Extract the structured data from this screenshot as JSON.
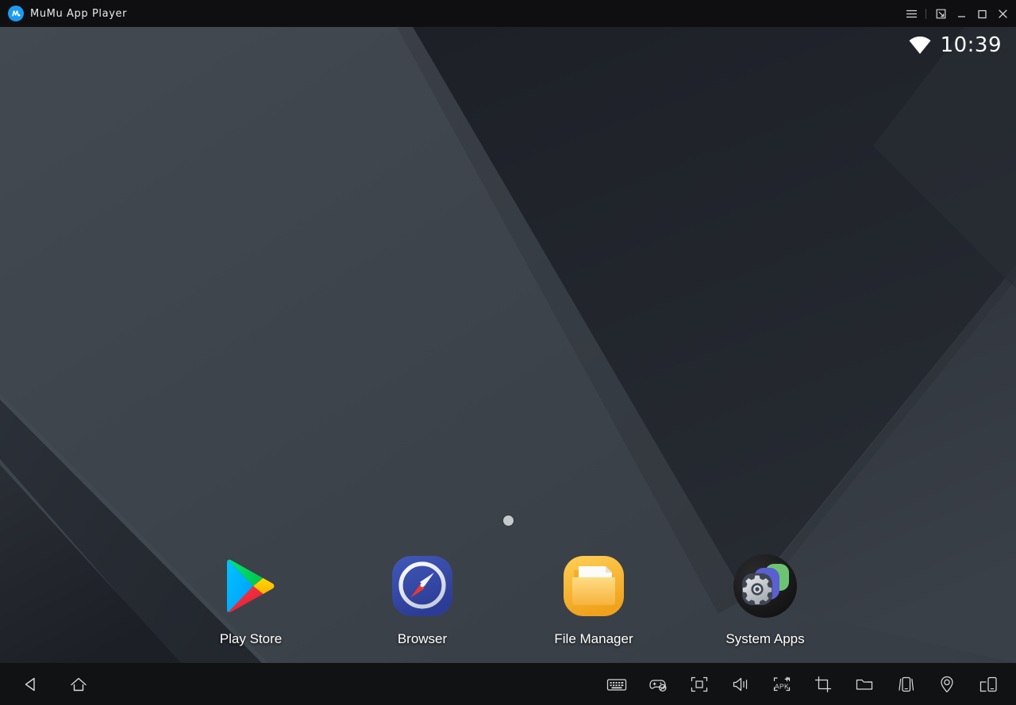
{
  "window": {
    "title": "MuMu App Player",
    "logo_icon": "mumu-logo-icon",
    "controls": [
      {
        "name": "menu-button",
        "icon": "hamburger-menu-icon",
        "label": "Menu"
      },
      {
        "name": "resize-button",
        "icon": "resize-window-icon",
        "label": "Resize"
      },
      {
        "name": "minimize-button",
        "icon": "minimize-icon",
        "label": "Minimize"
      },
      {
        "name": "maximize-button",
        "icon": "maximize-icon",
        "label": "Maximize"
      },
      {
        "name": "close-button",
        "icon": "close-icon",
        "label": "Close"
      }
    ]
  },
  "statusbar": {
    "wifi_icon": "wifi-icon",
    "time": "10:39"
  },
  "home": {
    "page_indicator": {
      "total": 1,
      "current": 1
    },
    "apps": [
      {
        "label": "Play Store",
        "icon": "play-store-icon"
      },
      {
        "label": "Browser",
        "icon": "browser-compass-icon"
      },
      {
        "label": "File Manager",
        "icon": "file-manager-folder-icon"
      },
      {
        "label": "System Apps",
        "icon": "system-apps-gear-icon"
      }
    ]
  },
  "navbar": {
    "system_buttons": [
      {
        "label": "Back",
        "icon": "back-triangle-icon"
      },
      {
        "label": "Home",
        "icon": "home-house-icon"
      }
    ],
    "tools": [
      {
        "label": "Keyboard Mapping",
        "icon": "keyboard-icon"
      },
      {
        "label": "Gamepad",
        "icon": "gamepad-disabled-icon"
      },
      {
        "label": "Full Screen",
        "icon": "fullscreen-icon"
      },
      {
        "label": "Volume",
        "icon": "volume-icon"
      },
      {
        "label": "Install APK",
        "icon": "install-apk-icon"
      },
      {
        "label": "Screenshot",
        "icon": "crop-screenshot-icon"
      },
      {
        "label": "Shared Folder",
        "icon": "folder-icon"
      },
      {
        "label": "Shake",
        "icon": "shake-phone-icon"
      },
      {
        "label": "Location",
        "icon": "location-pin-icon"
      },
      {
        "label": "Multi Window",
        "icon": "multi-window-icon"
      }
    ]
  },
  "colors": {
    "titlebar_bg": "#0f0f11",
    "navbar_bg": "#111214",
    "wallpaper_light": "#3d434b",
    "wallpaper_mid": "#363b43",
    "wallpaper_dark": "#20232a",
    "accent_blue": "#1b9bf0",
    "text_primary": "#ffffff",
    "page_dot": "#c6c9cb"
  }
}
